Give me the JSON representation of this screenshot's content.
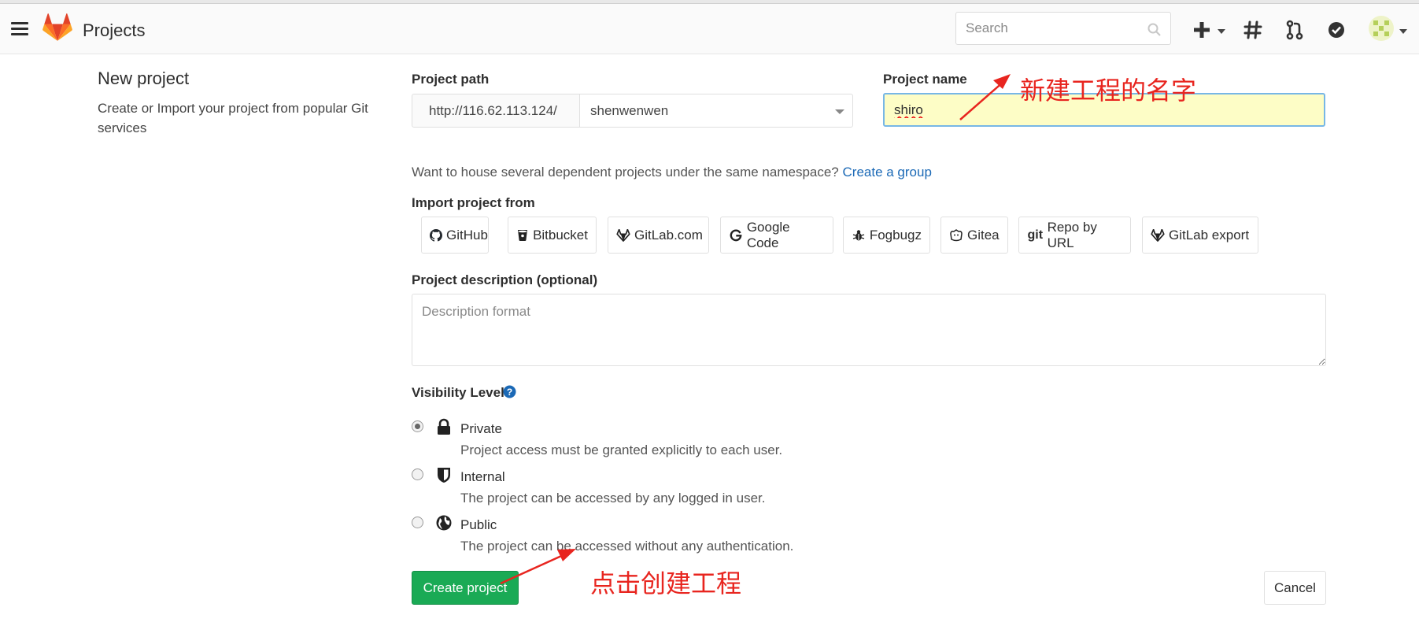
{
  "navbar": {
    "title": "Projects",
    "search_placeholder": "Search",
    "icons": [
      "menu-icon",
      "gitlab-logo",
      "search-icon",
      "plus-icon",
      "hash-icon",
      "merge-request-icon",
      "todo-check-icon",
      "avatar"
    ]
  },
  "sidebar": {
    "title": "New project",
    "description": "Create or Import your project from popular Git services"
  },
  "form": {
    "path_label": "Project path",
    "path_prefix": "http://116.62.113.124/",
    "namespace": "shenwenwen",
    "name_label": "Project name",
    "name_value": "shiro",
    "group_hint": "Want to house several dependent projects under the same namespace?",
    "group_link": "Create a group",
    "import_label": "Import project from",
    "import_sources": [
      {
        "label": "GitHub",
        "icon": "github-icon"
      },
      {
        "label": "Bitbucket",
        "icon": "bitbucket-icon"
      },
      {
        "label": "GitLab.com",
        "icon": "gitlab-icon"
      },
      {
        "label": "Google Code",
        "icon": "google-icon"
      },
      {
        "label": "Fogbugz",
        "icon": "bug-icon"
      },
      {
        "label": "Gitea",
        "icon": "gitea-icon"
      },
      {
        "label": "Repo by URL",
        "icon": "git-icon",
        "icon_text": "git"
      },
      {
        "label": "GitLab export",
        "icon": "gitlab-icon"
      }
    ],
    "description_label": "Project description (optional)",
    "description_placeholder": "Description format",
    "visibility_label": "Visibility Level",
    "visibility_options": [
      {
        "label": "Private",
        "description": "Project access must be granted explicitly to each user.",
        "checked": true,
        "icon": "lock-icon"
      },
      {
        "label": "Internal",
        "description": "The project can be accessed by any logged in user.",
        "checked": false,
        "icon": "shield-icon"
      },
      {
        "label": "Public",
        "description": "The project can be accessed without any authentication.",
        "checked": false,
        "icon": "globe-icon"
      }
    ],
    "create_label": "Create project",
    "cancel_label": "Cancel"
  },
  "annotations": {
    "name_note": "新建工程的名字",
    "create_note": "点击创建工程",
    "color": "#e8251f"
  },
  "colors": {
    "create_button": "#1aaa55",
    "link": "#1b69b6",
    "name_input_bg": "#fdfdc6",
    "focus_border": "#77b7e6"
  }
}
